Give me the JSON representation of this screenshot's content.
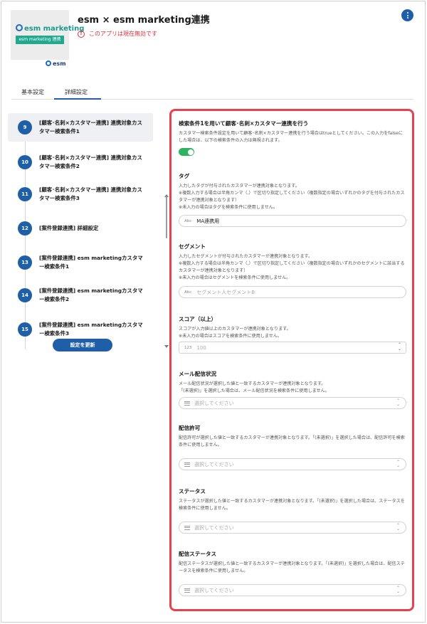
{
  "header": {
    "logo_brand_text": "esm marketing",
    "logo_badge_text": "esm marketing 連携",
    "vendor_logo_text": "esm",
    "title": "esm × esm marketing連携",
    "warning": "このアプリは現在無効です",
    "more_icon": "more-vertical-icon"
  },
  "tabs": [
    {
      "label": "基本設定",
      "active": false
    },
    {
      "label": "詳細設定",
      "active": true
    }
  ],
  "steps": [
    {
      "num": "9",
      "label": "[顧客･名刺×カスタマー連携] 連携対象カスタマー検索条件1",
      "active": true
    },
    {
      "num": "10",
      "label": "[顧客･名刺×カスタマー連携] 連携対象カスタマー検索条件2",
      "active": false
    },
    {
      "num": "11",
      "label": "[顧客･名刺×カスタマー連携] 連携対象カスタマー検索条件3",
      "active": false
    },
    {
      "num": "12",
      "label": "[案件登録連携] 詳細設定",
      "active": false
    },
    {
      "num": "13",
      "label": "[案件登録連携] esm marketingカスタマー検索条件1",
      "active": false
    },
    {
      "num": "14",
      "label": "[案件登録連携] esm marketingカスタマー検索条件2",
      "active": false
    },
    {
      "num": "15",
      "label": "[案件登録連携] esm marketingカスタマー検索条件3",
      "active": false
    }
  ],
  "update_button": "設定を更新",
  "form": {
    "use_condition": {
      "title": "検索条件1を用いて顧客･名刺×カスタマー連携を行う",
      "desc": "カスタマー検索条件設定を用いて顧客･名刺×カスタマー連携を行う場合はtrueとしてください。この入力をfalseにした場合は、以下の検索条件の入力は無視されます。",
      "enabled": true
    },
    "tag": {
      "title": "タグ",
      "desc": "入力したタグが付与されたカスタマーが連携対象となります。",
      "note1": "※複数入力する場合は半角カンマ（,）で区切り指定してください（複数指定の場合いずれかのタグを付与されたカスタマーが連携対象となります）",
      "note2": "※未入力の場合はタグを検索条件に使用しません。",
      "prefix": "Abc",
      "value": "MA連携用"
    },
    "segment": {
      "title": "セグメント",
      "desc": "入力したセグメントが付与されたカスタマーが連携対象となります。",
      "note1": "※複数入力する場合は半角カンマ（,）で区切り指定してください（複数指定の場合いずれかのセグメントに該当するカスタマーが連携対象となります）",
      "note2": "※未入力の場合はセグメントを検索条件に使用しません。",
      "prefix": "Abc",
      "placeholder": "セグメント人セグメントB"
    },
    "score": {
      "title": "スコア（以上）",
      "desc": "スコアが入力値以上のカスタマーが連携対象となります。",
      "note": "※未入力の場合はスコアを検索条件に使用しません。",
      "prefix": "123",
      "placeholder": "100"
    },
    "mail_status": {
      "title": "メール配信状況",
      "desc": "メール配信状況が選択した値と一致するカスタマーが連携対象となります。",
      "note": "「(未選択)」を選択した場合は、メール配信状況を検索条件に使用しません。",
      "placeholder": "選択してください"
    },
    "permission": {
      "title": "配信許可",
      "desc": "配信許可が選択した値と一致するカスタマーが連携対象となります。「(未選択)」を選択した場合は、配信許可を検索条件に使用しません。",
      "placeholder": "選択してください"
    },
    "status": {
      "title": "ステータス",
      "desc": "ステータスが選択した値と一致するカスタマーが連携対象となります。「(未選択)」を選択した場合は、ステータスを検索条件に使用しません。",
      "placeholder": "選択してください"
    },
    "delivery_status": {
      "title": "配信ステータス",
      "desc": "配信ステータスが選択した値と一致するカスタマーが連携対象となります。「(未選択)」を選択した場合は、配信ステータスを検索条件に使用しません。",
      "placeholder": "選択してください"
    }
  },
  "colors": {
    "primary": "#1f5fa8",
    "highlight_border": "#e8414d",
    "toggle_on": "#2fb360",
    "warning": "#d9303b"
  }
}
